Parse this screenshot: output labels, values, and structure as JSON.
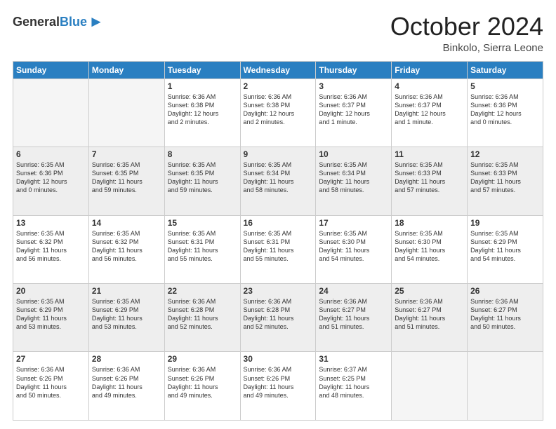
{
  "header": {
    "logo_general": "General",
    "logo_blue": "Blue",
    "month_title": "October 2024",
    "location": "Binkolo, Sierra Leone"
  },
  "calendar": {
    "headers": [
      "Sunday",
      "Monday",
      "Tuesday",
      "Wednesday",
      "Thursday",
      "Friday",
      "Saturday"
    ],
    "rows": [
      [
        {
          "day": "",
          "info": ""
        },
        {
          "day": "",
          "info": ""
        },
        {
          "day": "1",
          "info": "Sunrise: 6:36 AM\nSunset: 6:38 PM\nDaylight: 12 hours\nand 2 minutes."
        },
        {
          "day": "2",
          "info": "Sunrise: 6:36 AM\nSunset: 6:38 PM\nDaylight: 12 hours\nand 2 minutes."
        },
        {
          "day": "3",
          "info": "Sunrise: 6:36 AM\nSunset: 6:37 PM\nDaylight: 12 hours\nand 1 minute."
        },
        {
          "day": "4",
          "info": "Sunrise: 6:36 AM\nSunset: 6:37 PM\nDaylight: 12 hours\nand 1 minute."
        },
        {
          "day": "5",
          "info": "Sunrise: 6:36 AM\nSunset: 6:36 PM\nDaylight: 12 hours\nand 0 minutes."
        }
      ],
      [
        {
          "day": "6",
          "info": "Sunrise: 6:35 AM\nSunset: 6:36 PM\nDaylight: 12 hours\nand 0 minutes."
        },
        {
          "day": "7",
          "info": "Sunrise: 6:35 AM\nSunset: 6:35 PM\nDaylight: 11 hours\nand 59 minutes."
        },
        {
          "day": "8",
          "info": "Sunrise: 6:35 AM\nSunset: 6:35 PM\nDaylight: 11 hours\nand 59 minutes."
        },
        {
          "day": "9",
          "info": "Sunrise: 6:35 AM\nSunset: 6:34 PM\nDaylight: 11 hours\nand 58 minutes."
        },
        {
          "day": "10",
          "info": "Sunrise: 6:35 AM\nSunset: 6:34 PM\nDaylight: 11 hours\nand 58 minutes."
        },
        {
          "day": "11",
          "info": "Sunrise: 6:35 AM\nSunset: 6:33 PM\nDaylight: 11 hours\nand 57 minutes."
        },
        {
          "day": "12",
          "info": "Sunrise: 6:35 AM\nSunset: 6:33 PM\nDaylight: 11 hours\nand 57 minutes."
        }
      ],
      [
        {
          "day": "13",
          "info": "Sunrise: 6:35 AM\nSunset: 6:32 PM\nDaylight: 11 hours\nand 56 minutes."
        },
        {
          "day": "14",
          "info": "Sunrise: 6:35 AM\nSunset: 6:32 PM\nDaylight: 11 hours\nand 56 minutes."
        },
        {
          "day": "15",
          "info": "Sunrise: 6:35 AM\nSunset: 6:31 PM\nDaylight: 11 hours\nand 55 minutes."
        },
        {
          "day": "16",
          "info": "Sunrise: 6:35 AM\nSunset: 6:31 PM\nDaylight: 11 hours\nand 55 minutes."
        },
        {
          "day": "17",
          "info": "Sunrise: 6:35 AM\nSunset: 6:30 PM\nDaylight: 11 hours\nand 54 minutes."
        },
        {
          "day": "18",
          "info": "Sunrise: 6:35 AM\nSunset: 6:30 PM\nDaylight: 11 hours\nand 54 minutes."
        },
        {
          "day": "19",
          "info": "Sunrise: 6:35 AM\nSunset: 6:29 PM\nDaylight: 11 hours\nand 54 minutes."
        }
      ],
      [
        {
          "day": "20",
          "info": "Sunrise: 6:35 AM\nSunset: 6:29 PM\nDaylight: 11 hours\nand 53 minutes."
        },
        {
          "day": "21",
          "info": "Sunrise: 6:35 AM\nSunset: 6:29 PM\nDaylight: 11 hours\nand 53 minutes."
        },
        {
          "day": "22",
          "info": "Sunrise: 6:36 AM\nSunset: 6:28 PM\nDaylight: 11 hours\nand 52 minutes."
        },
        {
          "day": "23",
          "info": "Sunrise: 6:36 AM\nSunset: 6:28 PM\nDaylight: 11 hours\nand 52 minutes."
        },
        {
          "day": "24",
          "info": "Sunrise: 6:36 AM\nSunset: 6:27 PM\nDaylight: 11 hours\nand 51 minutes."
        },
        {
          "day": "25",
          "info": "Sunrise: 6:36 AM\nSunset: 6:27 PM\nDaylight: 11 hours\nand 51 minutes."
        },
        {
          "day": "26",
          "info": "Sunrise: 6:36 AM\nSunset: 6:27 PM\nDaylight: 11 hours\nand 50 minutes."
        }
      ],
      [
        {
          "day": "27",
          "info": "Sunrise: 6:36 AM\nSunset: 6:26 PM\nDaylight: 11 hours\nand 50 minutes."
        },
        {
          "day": "28",
          "info": "Sunrise: 6:36 AM\nSunset: 6:26 PM\nDaylight: 11 hours\nand 49 minutes."
        },
        {
          "day": "29",
          "info": "Sunrise: 6:36 AM\nSunset: 6:26 PM\nDaylight: 11 hours\nand 49 minutes."
        },
        {
          "day": "30",
          "info": "Sunrise: 6:36 AM\nSunset: 6:26 PM\nDaylight: 11 hours\nand 49 minutes."
        },
        {
          "day": "31",
          "info": "Sunrise: 6:37 AM\nSunset: 6:25 PM\nDaylight: 11 hours\nand 48 minutes."
        },
        {
          "day": "",
          "info": ""
        },
        {
          "day": "",
          "info": ""
        }
      ]
    ]
  }
}
